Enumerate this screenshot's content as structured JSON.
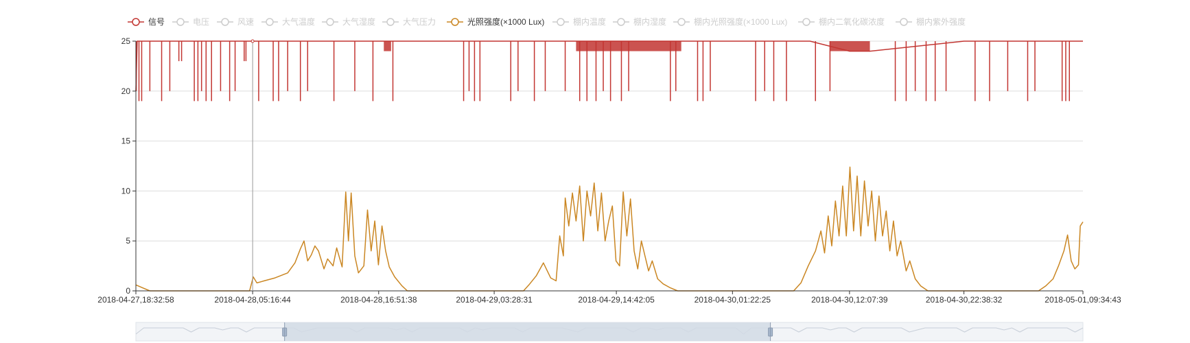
{
  "colors": {
    "signal": "#c23531",
    "light": "#ca8622",
    "inactive": "#cccccc",
    "axis": "#333333",
    "grid": "#dddddd",
    "slider_fill": "#d2dbe5",
    "slider_handle": "#a7b7cc"
  },
  "legend": [
    {
      "label": "信号",
      "active": true,
      "color": "#c23531"
    },
    {
      "label": "电压",
      "active": false
    },
    {
      "label": "风速",
      "active": false
    },
    {
      "label": "大气温度",
      "active": false
    },
    {
      "label": "大气湿度",
      "active": false
    },
    {
      "label": "大气压力",
      "active": false
    },
    {
      "label": "光照强度(×1000 Lux)",
      "active": true,
      "color": "#ca8622"
    },
    {
      "label": "棚内温度",
      "active": false
    },
    {
      "label": "棚内湿度",
      "active": false
    },
    {
      "label": "棚内光照强度(×1000 Lux)",
      "active": false
    },
    {
      "label": "棚内二氧化碳浓度",
      "active": false
    },
    {
      "label": "棚内紫外强度",
      "active": false
    }
  ],
  "chart_data": {
    "type": "line",
    "x_type": "time",
    "xlim": [
      "2018-04-27,18:32:58",
      "2018-05-01,09:34:43"
    ],
    "ylim": [
      0,
      25
    ],
    "grid": true,
    "legend_position": "top",
    "y_ticks": [
      "0",
      "5",
      "10",
      "15",
      "20",
      "25"
    ],
    "x_ticks": [
      "2018-04-27,18:32:58",
      "2018-04-28,05:16:44",
      "2018-04-28,16:51:38",
      "2018-04-29,03:28:31",
      "2018-04-29,14:42:05",
      "2018-04-30,01:22:25",
      "2018-04-30,12:07:39",
      "2018-04-30,22:38:32",
      "2018-05-01,09:34:43"
    ],
    "series": [
      {
        "name": "信号",
        "baseline": 25,
        "points": [
          [
            "2018-04-27,18:32:58",
            20
          ],
          [
            "2018-04-27,18:40:00",
            25
          ],
          [
            "2018-04-27,20:30:00",
            25
          ],
          [
            "2018-04-27,22:00:00",
            25
          ],
          [
            "2018-04-28,05:16:44",
            25
          ],
          [
            "2018-04-29,03:28:31",
            25
          ],
          [
            "2018-04-29,14:42:05",
            25
          ],
          [
            "2018-04-30,01:22:25",
            25
          ],
          [
            "2018-04-30,08:30:00",
            25
          ],
          [
            "2018-04-30,12:07:39",
            24
          ],
          [
            "2018-04-30,14:00:00",
            24
          ],
          [
            "2018-04-30,22:38:32",
            25
          ],
          [
            "2018-05-01,09:34:43",
            25
          ]
        ],
        "dips": [
          [
            "2018-04-27,18:35:00",
            20
          ],
          [
            "2018-04-27,18:50:00",
            19
          ],
          [
            "2018-04-27,19:05:00",
            19
          ],
          [
            "2018-04-27,19:50:00",
            20
          ],
          [
            "2018-04-27,20:55:00",
            19
          ],
          [
            "2018-04-27,21:40:00",
            20
          ],
          [
            "2018-04-27,22:30:00",
            23
          ],
          [
            "2018-04-27,22:45:00",
            23
          ],
          [
            "2018-04-27,23:55:00",
            19
          ],
          [
            "2018-04-28,00:15:00",
            19
          ],
          [
            "2018-04-28,00:35:00",
            20
          ],
          [
            "2018-04-28,01:00:00",
            19
          ],
          [
            "2018-04-28,01:30:00",
            19
          ],
          [
            "2018-04-28,02:20:00",
            20
          ],
          [
            "2018-04-28,03:10:00",
            19
          ],
          [
            "2018-04-28,03:40:00",
            20
          ],
          [
            "2018-04-28,04:30:00",
            23
          ],
          [
            "2018-04-28,04:40:00",
            23
          ],
          [
            "2018-04-28,05:50:00",
            19
          ],
          [
            "2018-04-28,07:10:00",
            19
          ],
          [
            "2018-04-28,07:40:00",
            19
          ],
          [
            "2018-04-28,08:30:00",
            20
          ],
          [
            "2018-04-28,09:40:00",
            19
          ],
          [
            "2018-04-28,10:20:00",
            20
          ],
          [
            "2018-04-28,12:45:00",
            19
          ],
          [
            "2018-04-28,14:40:00",
            20
          ],
          [
            "2018-04-28,16:20:00",
            19
          ],
          [
            "2018-04-28,18:10:00",
            19
          ],
          [
            "2018-04-29,00:40:00",
            19
          ],
          [
            "2018-04-29,01:10:00",
            20
          ],
          [
            "2018-04-29,01:40:00",
            19
          ],
          [
            "2018-04-29,02:10:00",
            19
          ],
          [
            "2018-04-29,05:00:00",
            19
          ],
          [
            "2018-04-29,05:40:00",
            20
          ],
          [
            "2018-04-29,07:10:00",
            19
          ],
          [
            "2018-04-29,08:10:00",
            20
          ],
          [
            "2018-04-29,10:00:00",
            20
          ],
          [
            "2018-04-29,11:20:00",
            19
          ],
          [
            "2018-04-29,12:00:00",
            19
          ],
          [
            "2018-04-29,12:50:00",
            19
          ],
          [
            "2018-04-29,13:30:00",
            20
          ],
          [
            "2018-04-29,14:10:00",
            19
          ],
          [
            "2018-04-29,15:10:00",
            19
          ],
          [
            "2018-04-29,15:50:00",
            20
          ],
          [
            "2018-04-29,19:40:00",
            19
          ],
          [
            "2018-04-29,20:10:00",
            20
          ],
          [
            "2018-04-29,22:10:00",
            19
          ],
          [
            "2018-04-29,22:40:00",
            19
          ],
          [
            "2018-04-29,23:20:00",
            20
          ],
          [
            "2018-04-30,03:30:00",
            19
          ],
          [
            "2018-04-30,04:20:00",
            20
          ],
          [
            "2018-04-30,05:10:00",
            19
          ],
          [
            "2018-04-30,06:20:00",
            19
          ],
          [
            "2018-04-30,09:00:00",
            19
          ],
          [
            "2018-04-30,10:20:00",
            20
          ],
          [
            "2018-04-30,16:20:00",
            19
          ],
          [
            "2018-04-30,17:20:00",
            19
          ],
          [
            "2018-04-30,18:10:00",
            20
          ],
          [
            "2018-04-30,19:10:00",
            19
          ],
          [
            "2018-04-30,20:00:00",
            19
          ],
          [
            "2018-04-30,21:00:00",
            20
          ],
          [
            "2018-04-30,23:40:00",
            19
          ],
          [
            "2018-05-01,01:00:00",
            19
          ],
          [
            "2018-05-01,02:40:00",
            20
          ],
          [
            "2018-05-01,04:30:00",
            19
          ],
          [
            "2018-05-01,05:10:00",
            20
          ],
          [
            "2018-05-01,07:40:00",
            19
          ],
          [
            "2018-05-01,08:00:00",
            19
          ],
          [
            "2018-05-01,08:20:00",
            19
          ]
        ],
        "dense_ranges": [
          [
            "2018-04-28,17:20:00",
            "2018-04-28,18:00:00"
          ],
          [
            "2018-04-29,11:00:00",
            "2018-04-29,20:40:00"
          ],
          [
            "2018-04-30,10:20:00",
            "2018-04-30,14:00:00"
          ]
        ]
      },
      {
        "name": "光照强度(×1000 Lux)",
        "points": [
          [
            "2018-04-27,18:32:58",
            0.6
          ],
          [
            "2018-04-27,19:10:00",
            0.3
          ],
          [
            "2018-04-27,19:50:00",
            0
          ],
          [
            "2018-04-28,05:00:00",
            0
          ],
          [
            "2018-04-28,05:20:00",
            1.4
          ],
          [
            "2018-04-28,05:40:00",
            0.8
          ],
          [
            "2018-04-28,06:20:00",
            1.0
          ],
          [
            "2018-04-28,07:20:00",
            1.3
          ],
          [
            "2018-04-28,08:30:00",
            1.8
          ],
          [
            "2018-04-28,09:10:00",
            2.8
          ],
          [
            "2018-04-28,09:40:00",
            4.2
          ],
          [
            "2018-04-28,10:00:00",
            5.0
          ],
          [
            "2018-04-28,10:20:00",
            3.0
          ],
          [
            "2018-04-28,10:40:00",
            3.6
          ],
          [
            "2018-04-28,11:00:00",
            4.5
          ],
          [
            "2018-04-28,11:20:00",
            4.0
          ],
          [
            "2018-04-28,11:50:00",
            2.2
          ],
          [
            "2018-04-28,12:10:00",
            3.2
          ],
          [
            "2018-04-28,12:40:00",
            2.5
          ],
          [
            "2018-04-28,13:00:00",
            4.3
          ],
          [
            "2018-04-28,13:30:00",
            2.4
          ],
          [
            "2018-04-28,13:50:00",
            9.9
          ],
          [
            "2018-04-28,14:05:00",
            5.0
          ],
          [
            "2018-04-28,14:20:00",
            9.8
          ],
          [
            "2018-04-28,14:40:00",
            3.5
          ],
          [
            "2018-04-28,15:00:00",
            1.8
          ],
          [
            "2018-04-28,15:30:00",
            2.5
          ],
          [
            "2018-04-28,15:50:00",
            8.1
          ],
          [
            "2018-04-28,16:10:00",
            4.0
          ],
          [
            "2018-04-28,16:30:00",
            7.0
          ],
          [
            "2018-04-28,16:50:00",
            2.6
          ],
          [
            "2018-04-28,17:10:00",
            6.5
          ],
          [
            "2018-04-28,17:30:00",
            4.0
          ],
          [
            "2018-04-28,17:50:00",
            2.4
          ],
          [
            "2018-04-28,18:20:00",
            1.4
          ],
          [
            "2018-04-28,19:00:00",
            0.5
          ],
          [
            "2018-04-28,19:30:00",
            0
          ],
          [
            "2018-04-29,06:10:00",
            0
          ],
          [
            "2018-04-29,06:40:00",
            0.6
          ],
          [
            "2018-04-29,07:20:00",
            1.5
          ],
          [
            "2018-04-29,08:00:00",
            2.8
          ],
          [
            "2018-04-29,08:40:00",
            1.3
          ],
          [
            "2018-04-29,09:10:00",
            1.0
          ],
          [
            "2018-04-29,09:30:00",
            5.5
          ],
          [
            "2018-04-29,09:50:00",
            3.5
          ],
          [
            "2018-04-29,10:00:00",
            9.3
          ],
          [
            "2018-04-29,10:20:00",
            6.5
          ],
          [
            "2018-04-29,10:40:00",
            9.8
          ],
          [
            "2018-04-29,11:00:00",
            7.0
          ],
          [
            "2018-04-29,11:20:00",
            10.5
          ],
          [
            "2018-04-29,11:40:00",
            5.0
          ],
          [
            "2018-04-29,12:00:00",
            10.0
          ],
          [
            "2018-04-29,12:20:00",
            7.5
          ],
          [
            "2018-04-29,12:40:00",
            10.8
          ],
          [
            "2018-04-29,13:00:00",
            6.0
          ],
          [
            "2018-04-29,13:20:00",
            9.8
          ],
          [
            "2018-04-29,13:40:00",
            5.0
          ],
          [
            "2018-04-29,14:00:00",
            7.0
          ],
          [
            "2018-04-29,14:20:00",
            8.5
          ],
          [
            "2018-04-29,14:40:00",
            3.0
          ],
          [
            "2018-04-29,15:00:00",
            2.5
          ],
          [
            "2018-04-29,15:20:00",
            9.9
          ],
          [
            "2018-04-29,15:40:00",
            5.5
          ],
          [
            "2018-04-29,16:00:00",
            9.2
          ],
          [
            "2018-04-29,16:20:00",
            4.0
          ],
          [
            "2018-04-29,16:40:00",
            2.2
          ],
          [
            "2018-04-29,17:00:00",
            5.0
          ],
          [
            "2018-04-29,17:20:00",
            3.5
          ],
          [
            "2018-04-29,17:40:00",
            2.0
          ],
          [
            "2018-04-29,18:00:00",
            3.0
          ],
          [
            "2018-04-29,18:30:00",
            1.2
          ],
          [
            "2018-04-29,19:00:00",
            0.7
          ],
          [
            "2018-04-29,19:40:00",
            0.3
          ],
          [
            "2018-04-29,20:20:00",
            0
          ],
          [
            "2018-04-30,07:00:00",
            0
          ],
          [
            "2018-04-30,07:40:00",
            0.8
          ],
          [
            "2018-04-30,08:20:00",
            2.5
          ],
          [
            "2018-04-30,09:00:00",
            4.0
          ],
          [
            "2018-04-30,09:30:00",
            6.0
          ],
          [
            "2018-04-30,09:50:00",
            3.8
          ],
          [
            "2018-04-30,10:10:00",
            7.5
          ],
          [
            "2018-04-30,10:30:00",
            4.5
          ],
          [
            "2018-04-30,10:50:00",
            9.0
          ],
          [
            "2018-04-30,11:10:00",
            5.5
          ],
          [
            "2018-04-30,11:30:00",
            10.5
          ],
          [
            "2018-04-30,11:50:00",
            5.5
          ],
          [
            "2018-04-30,12:10:00",
            12.4
          ],
          [
            "2018-04-30,12:30:00",
            6.0
          ],
          [
            "2018-04-30,12:50:00",
            11.5
          ],
          [
            "2018-04-30,13:10:00",
            5.5
          ],
          [
            "2018-04-30,13:30:00",
            11.0
          ],
          [
            "2018-04-30,13:50:00",
            6.5
          ],
          [
            "2018-04-30,14:10:00",
            10.0
          ],
          [
            "2018-04-30,14:30:00",
            5.0
          ],
          [
            "2018-04-30,14:50:00",
            9.5
          ],
          [
            "2018-04-30,15:10:00",
            5.5
          ],
          [
            "2018-04-30,15:30:00",
            8.0
          ],
          [
            "2018-04-30,15:50:00",
            4.0
          ],
          [
            "2018-04-30,16:10:00",
            7.0
          ],
          [
            "2018-04-30,16:30:00",
            3.5
          ],
          [
            "2018-04-30,16:50:00",
            5.0
          ],
          [
            "2018-04-30,17:20:00",
            2.0
          ],
          [
            "2018-04-30,17:40:00",
            3.0
          ],
          [
            "2018-04-30,18:10:00",
            1.2
          ],
          [
            "2018-04-30,18:40:00",
            0.5
          ],
          [
            "2018-04-30,19:20:00",
            0
          ],
          [
            "2018-05-01,05:30:00",
            0
          ],
          [
            "2018-05-01,06:10:00",
            0.5
          ],
          [
            "2018-05-01,06:50:00",
            1.2
          ],
          [
            "2018-05-01,07:20:00",
            2.5
          ],
          [
            "2018-05-01,07:50:00",
            4.0
          ],
          [
            "2018-05-01,08:10:00",
            5.6
          ],
          [
            "2018-05-01,08:30:00",
            3.0
          ],
          [
            "2018-05-01,08:50:00",
            2.2
          ],
          [
            "2018-05-01,09:10:00",
            2.6
          ],
          [
            "2018-05-01,09:20:00",
            6.5
          ],
          [
            "2018-05-01,09:34:43",
            6.9
          ]
        ]
      }
    ],
    "hover_time": "2018-04-28,05:16:44",
    "zoom_window": {
      "start_fraction": 0.157,
      "end_fraction": 0.67
    }
  }
}
